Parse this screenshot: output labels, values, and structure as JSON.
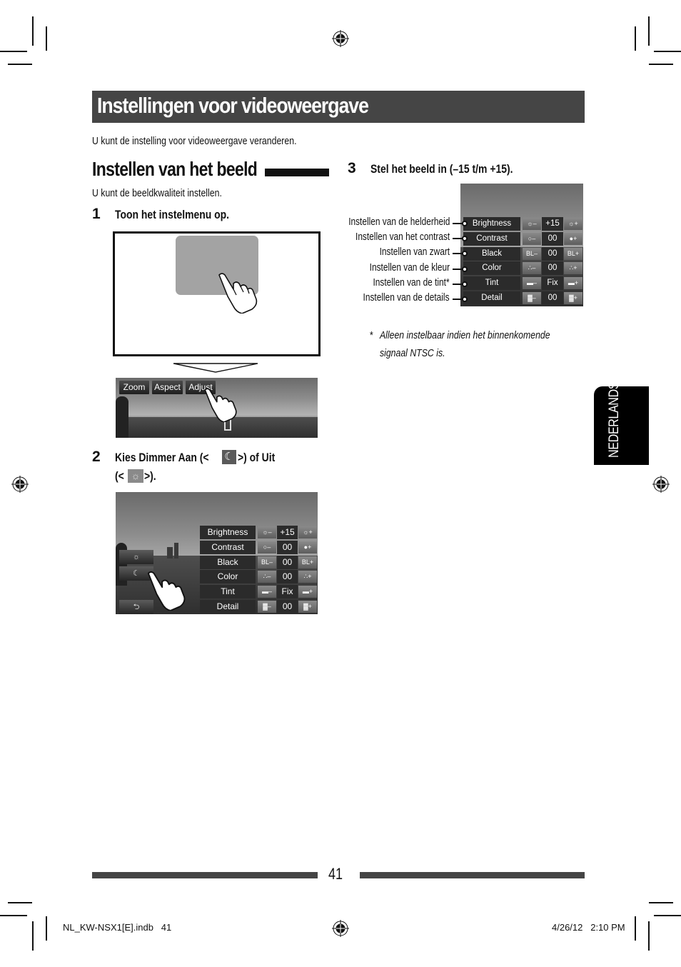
{
  "page": {
    "title": "Instellingen voor videoweergave",
    "intro": "U kunt de instelling voor videoweergave veranderen.",
    "language_tab": "NEDERLANDS",
    "page_number": "41"
  },
  "section": {
    "heading": "Instellen van het beeld",
    "subtitle": "U kunt de beeldkwaliteit instellen."
  },
  "steps": [
    {
      "number": "1",
      "text": "Toon het instelmenu op."
    },
    {
      "number": "2",
      "text_before_moon": "Kies Dimmer Aan (<",
      "text_between": ">) of Uit",
      "text_line2_open": "(<",
      "text_line2_close": ">)."
    },
    {
      "number": "3",
      "text": "Stel het beeld in (–15 t/m +15)."
    }
  ],
  "step1_toolbar": {
    "buttons": [
      "Zoom",
      "Aspect",
      "Adjust"
    ]
  },
  "step2_side_buttons": {
    "dimmer_off_icon": "sun-icon",
    "dimmer_on_icon": "moon-icon",
    "back_icon": "back-arrow-icon",
    "back_glyph": "⮌"
  },
  "adjust_panel": {
    "rows": [
      {
        "label": "Brightness",
        "minus_icon": "brightness-down-icon",
        "value": "+15",
        "plus_icon": "brightness-up-icon",
        "minus_glyph": "☼–",
        "plus_glyph": "☼+"
      },
      {
        "label": "Contrast",
        "minus_icon": "contrast-down-icon",
        "value": "00",
        "plus_icon": "contrast-up-icon",
        "minus_glyph": "○–",
        "plus_glyph": "●+"
      },
      {
        "label": "Black",
        "minus_icon": "black-down-icon",
        "value": "00",
        "plus_icon": "black-up-icon",
        "minus_glyph": "BL–",
        "plus_glyph": "BL+"
      },
      {
        "label": "Color",
        "minus_icon": "color-down-icon",
        "value": "00",
        "plus_icon": "color-up-icon",
        "minus_glyph": "∴–",
        "plus_glyph": "∴+"
      },
      {
        "label": "Tint",
        "minus_icon": "tint-down-icon",
        "value": "Fix",
        "plus_icon": "tint-up-icon",
        "minus_glyph": "▬–",
        "plus_glyph": "▬+"
      },
      {
        "label": "Detail",
        "minus_icon": "detail-down-icon",
        "value": "00",
        "plus_icon": "detail-up-icon",
        "minus_glyph": "▓–",
        "plus_glyph": "▓+"
      }
    ]
  },
  "callouts": [
    "Instellen van de helderheid",
    "Instellen van het contrast",
    "Instellen van zwart",
    "Instellen van de kleur",
    "Instellen van de tint*",
    "Instellen van de details"
  ],
  "footnote": {
    "marker": "*",
    "line1": "Alleen instelbaar indien het binnenkomende",
    "line2": "signaal NTSC is."
  },
  "slug": {
    "file": "NL_KW-NSX1[E].indb   41",
    "datetime": "4/26/12   2:10 PM"
  }
}
